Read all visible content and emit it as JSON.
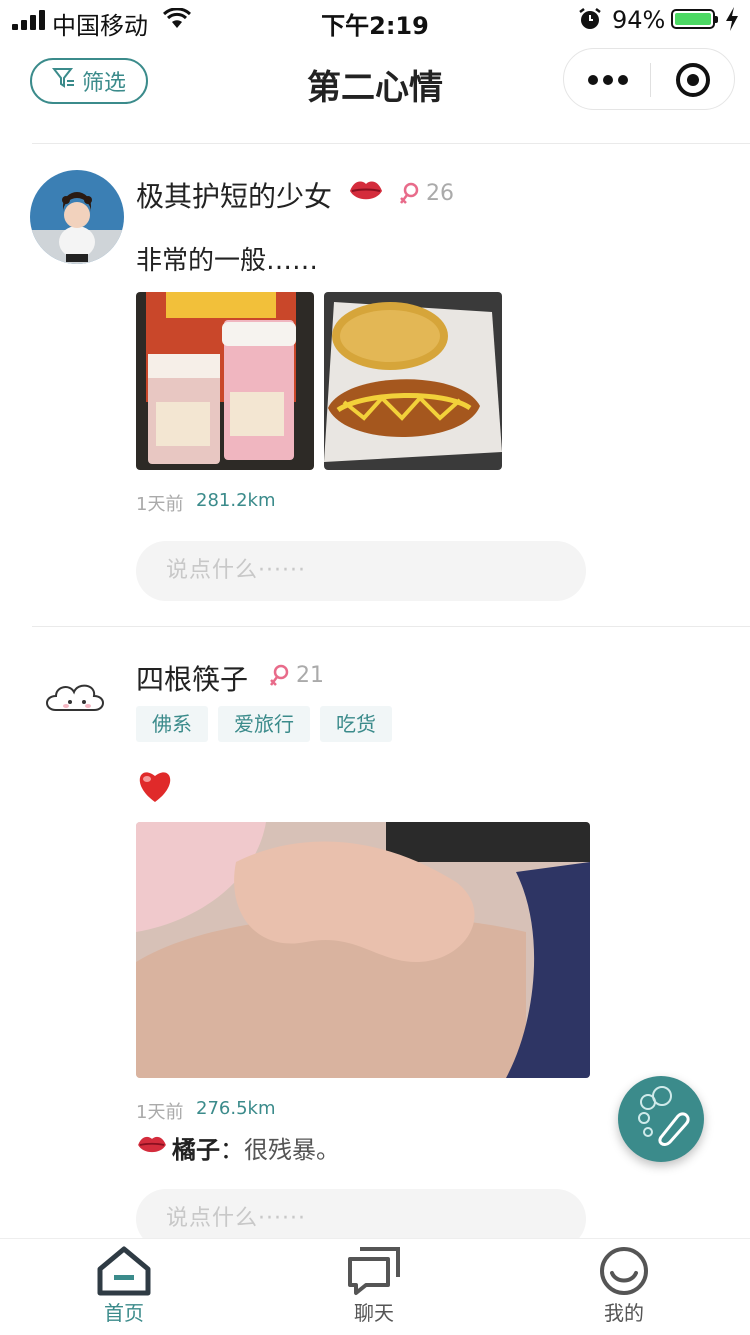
{
  "status_bar": {
    "carrier": "中国移动",
    "time": "下午2:19",
    "battery_percent": "94%",
    "battery_level": 0.94
  },
  "nav": {
    "filter_label": "筛选",
    "title": "第二心情"
  },
  "posts": [
    {
      "username": "极其护短的少女",
      "age": "26",
      "content": "非常的一般……",
      "time_ago": "1天前",
      "distance": "281.2km",
      "comment_placeholder": "说点什么······"
    },
    {
      "username": "四根筷子",
      "age": "21",
      "tags": [
        "佛系",
        "爱旅行",
        "吃货"
      ],
      "content": "❤️",
      "time_ago": "1天前",
      "distance": "276.5km",
      "comment_author": "橘子",
      "comment_sep": "：",
      "comment_text": "很残暴。",
      "comment_placeholder": "说点什么······"
    }
  ],
  "tabbar": {
    "items": [
      {
        "label": "首页",
        "active": true
      },
      {
        "label": "聊天",
        "active": false
      },
      {
        "label": "我的",
        "active": false
      }
    ]
  },
  "colors": {
    "accent": "#3b8b8b",
    "female": "#e86b8a",
    "muted": "#aaaaaa"
  }
}
